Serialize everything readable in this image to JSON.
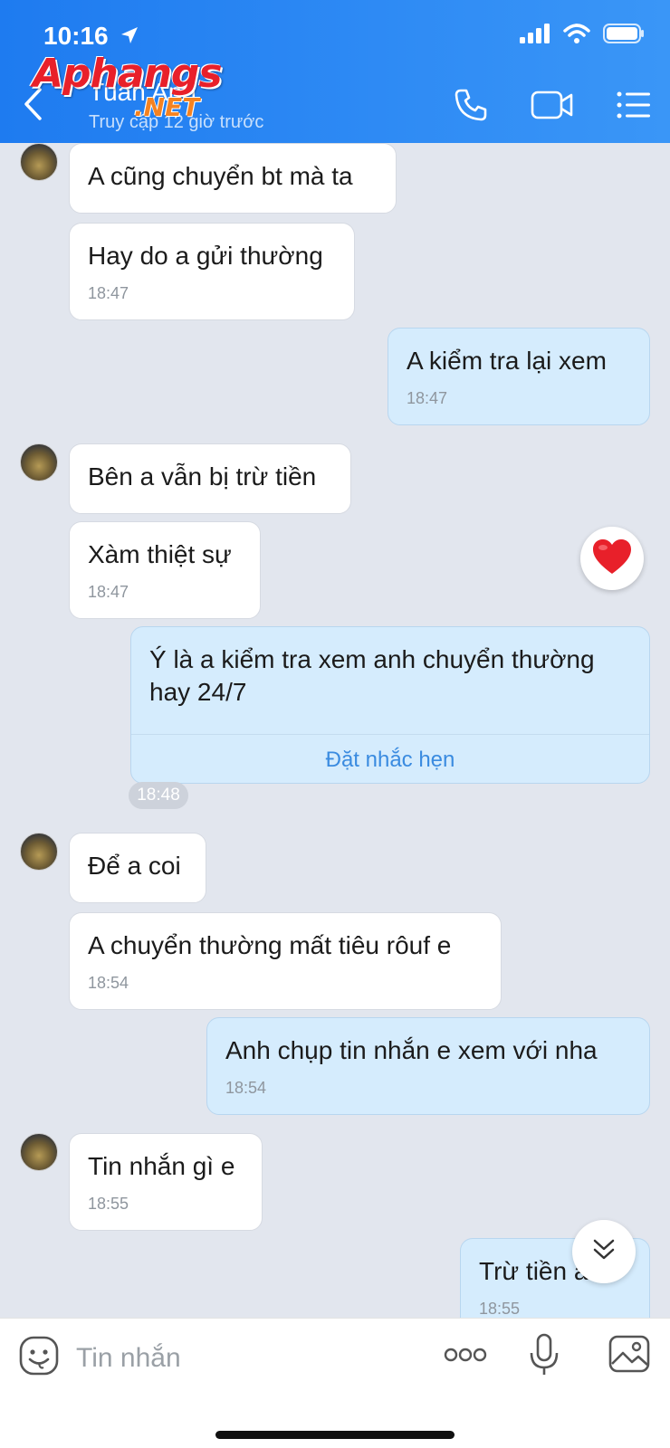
{
  "status_bar": {
    "time": "10:16",
    "icons": [
      "location-arrow-icon",
      "signal-icon",
      "wifi-icon",
      "battery-icon"
    ]
  },
  "header": {
    "contact_name": "Tuấn Anh",
    "contact_status": "Truy cập 12 giờ trước",
    "watermark": "Aphangs",
    "watermark_suffix": ".NET",
    "icons": [
      "back-icon",
      "phone-icon",
      "video-call-icon",
      "menu-icon"
    ]
  },
  "messages": [
    {
      "side": "in",
      "text": "A cũng chuyển bt mà ta",
      "time": ""
    },
    {
      "side": "in",
      "text": "Hay do a gửi thường",
      "time": "18:47"
    },
    {
      "side": "out",
      "text": "A kiểm tra lại xem",
      "time": "18:47"
    },
    {
      "side": "in",
      "text": "Bên a vẫn bị trừ tiền",
      "time": ""
    },
    {
      "side": "in",
      "text": "Xàm thiệt sự",
      "time": "18:47"
    },
    {
      "side": "out",
      "text_line1": "Ý là a kiểm tra xem anh chuyển thường",
      "text_line2": "hay 24/7",
      "action": "Đặt nhắc hẹn",
      "time": "18:48"
    },
    {
      "side": "in",
      "text": "Để a coi",
      "time": ""
    },
    {
      "side": "in",
      "text": "A chuyển thường mất tiêu rôuf e",
      "time": "18:54"
    },
    {
      "side": "out",
      "text": "Anh chụp tin nhắn e xem với nha",
      "time": "18:54"
    },
    {
      "side": "in",
      "text": "Tin nhắn gì e",
      "time": "18:55"
    },
    {
      "side": "out",
      "text": "Trừ tiền anh",
      "time": "18:55"
    }
  ],
  "composer": {
    "placeholder": "Tin nhắn",
    "icons": [
      "sticker-icon",
      "more-icon",
      "microphone-icon",
      "image-icon"
    ]
  },
  "colors": {
    "header_start": "#1e7bf0",
    "header_end": "#3a96f7",
    "chat_background": "#e2e6ee",
    "incoming_bubble": "#ffffff",
    "outgoing_bubble": "#d5ecfd",
    "link": "#3a8be0",
    "heart": "#e8202a"
  }
}
